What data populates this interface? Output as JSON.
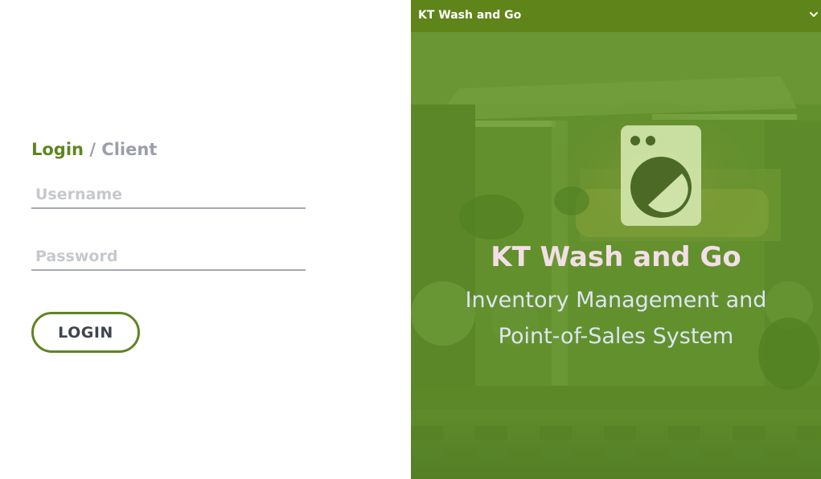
{
  "login": {
    "active_tab": "Login",
    "separator": "/",
    "alt_tab": "Client",
    "username_placeholder": "Username",
    "password_placeholder": "Password",
    "login_button": "LOGIN"
  },
  "header": {
    "brand": "KT Wash and Go",
    "menu_icon": "chevron-down-icon"
  },
  "hero": {
    "icon": "washing-machine-icon",
    "title": "KT Wash and Go",
    "subtitle_line1": "Inventory Management and",
    "subtitle_line2": "Point-of-Sales System"
  },
  "colors": {
    "accent_green": "#5f8521",
    "header_green": "#5f8419",
    "overlay_green": "#5d8c2d",
    "label_gray": "#9a9fab"
  }
}
